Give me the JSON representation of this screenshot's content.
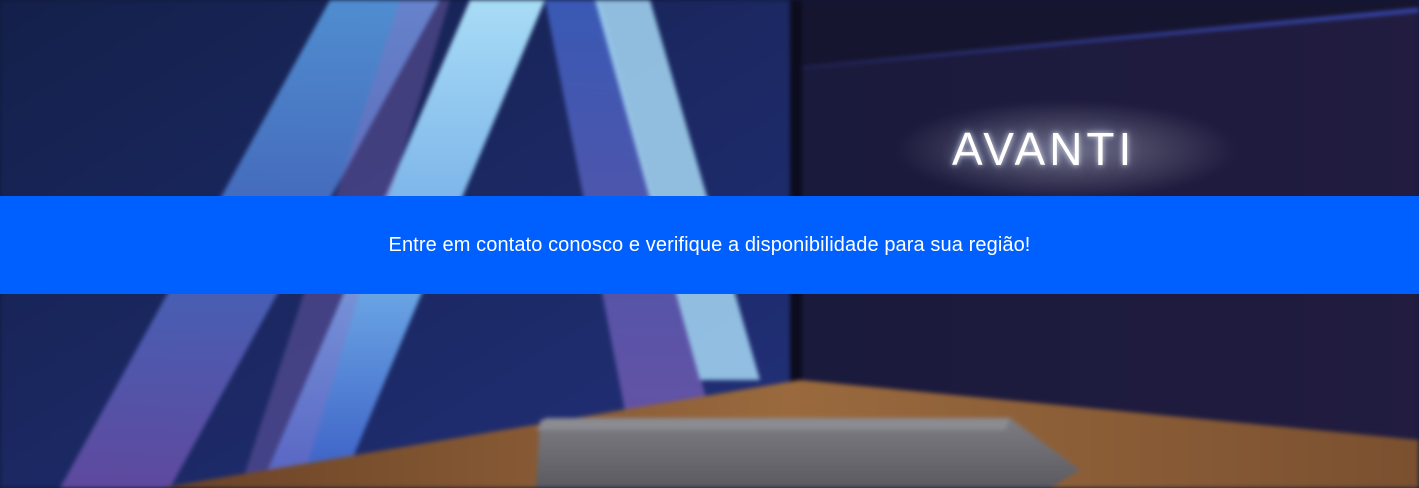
{
  "logo": {
    "text": "AVANTI"
  },
  "cta": {
    "text": "Entre em contato conosco e verifique a disponibilidade para sua região!"
  },
  "colors": {
    "band": "#0060ff",
    "wall_left": "#1c2a66",
    "wall_right": "#1a1838",
    "floor": "#8a5a36",
    "bench": "#6f6f74",
    "logo_glow": "#ffffff"
  },
  "icons": {
    "logo_mark": "avanti-a-stripes-icon"
  }
}
